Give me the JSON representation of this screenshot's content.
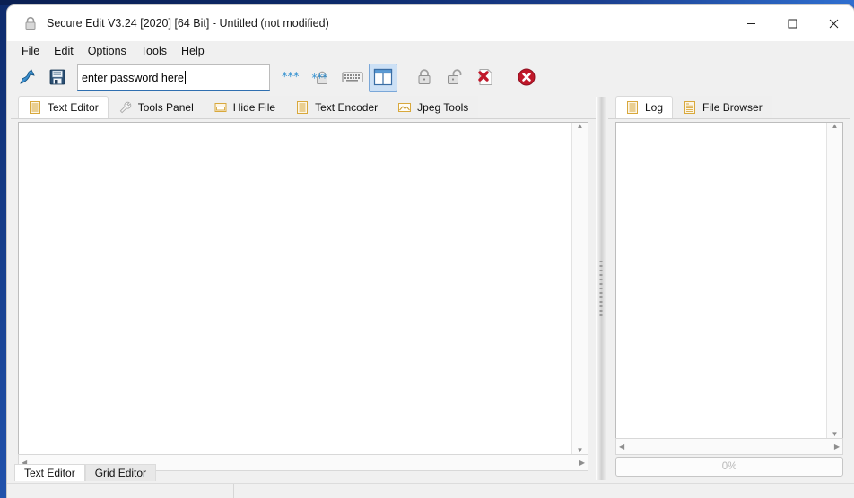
{
  "window": {
    "title": "Secure Edit V3.24 [2020] [64 Bit] - Untitled (not modified)",
    "title_icon": "lock-icon",
    "controls": {
      "minimize": "─",
      "maximize": "□",
      "close": "✕"
    }
  },
  "menubar": {
    "items": [
      {
        "label": "File"
      },
      {
        "label": "Edit"
      },
      {
        "label": "Options"
      },
      {
        "label": "Tools"
      },
      {
        "label": "Help"
      }
    ]
  },
  "toolbar": {
    "buttons": [
      {
        "name": "open-file-icon",
        "title": "Open"
      },
      {
        "name": "save-file-icon",
        "title": "Save"
      }
    ],
    "password_field": {
      "value": "enter password here",
      "placeholder": "enter password here"
    },
    "actions": [
      {
        "name": "asterisks-icon",
        "title": "Show Password Characters"
      },
      {
        "name": "asterisk-lock-icon",
        "title": "Mask Password"
      },
      {
        "name": "keyboard-icon",
        "title": "Virtual Keyboard"
      },
      {
        "name": "panel-toggle-icon",
        "title": "Toggle Panel",
        "selected": true
      },
      {
        "name": "lock-closed-icon",
        "title": "Encrypt"
      },
      {
        "name": "lock-open-icon",
        "title": "Decrypt"
      },
      {
        "name": "delete-file-icon",
        "title": "Delete File"
      },
      {
        "name": "close-circle-icon",
        "title": "Close"
      }
    ]
  },
  "left_panel": {
    "tabs": [
      {
        "label": "Text Editor",
        "icon": "document-lines-icon",
        "active": true
      },
      {
        "label": "Tools Panel",
        "icon": "wrench-icon",
        "active": false
      },
      {
        "label": "Hide File",
        "icon": "window-box-icon",
        "active": false
      },
      {
        "label": "Text Encoder",
        "icon": "document-lines-icon",
        "active": false
      },
      {
        "label": "Jpeg Tools",
        "icon": "image-icon",
        "active": false
      }
    ],
    "editor_text": "",
    "bottom_tabs": [
      {
        "label": "Text Editor",
        "active": true
      },
      {
        "label": "Grid Editor",
        "active": false
      }
    ]
  },
  "right_panel": {
    "tabs": [
      {
        "label": "Log",
        "icon": "document-lines-icon",
        "active": true
      },
      {
        "label": "File Browser",
        "icon": "file-list-icon",
        "active": false
      }
    ],
    "log_text": "",
    "progress": {
      "label": "0%",
      "value": 0
    }
  },
  "statusbar": {
    "left_text": "",
    "right_text": ""
  },
  "colors": {
    "accent": "#2f6fb0",
    "selected_button_bg": "#cce0f5",
    "desktop": "#1b3f8f",
    "tab_icon_border": "#d8a83c"
  }
}
